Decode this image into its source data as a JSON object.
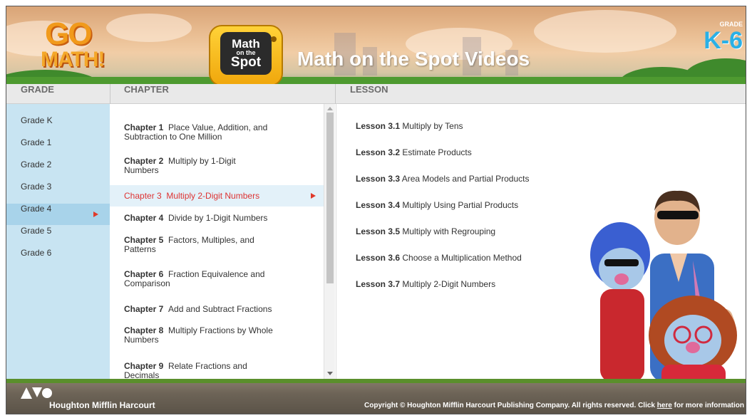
{
  "header": {
    "logo_go": "GO",
    "logo_math": "MATH!",
    "tv_line1": "Math",
    "tv_line2": "on the",
    "tv_line3": "Spot",
    "title": "Math on the Spot Videos",
    "grade_label": "GRADE",
    "grade_range": "K-6"
  },
  "columns": {
    "grade": "GRADE",
    "chapter": "CHAPTER",
    "lesson": "LESSON"
  },
  "grades": [
    "Grade K",
    "Grade 1",
    "Grade 2",
    "Grade 3",
    "Grade 4",
    "Grade 5",
    "Grade 6"
  ],
  "selected_grade": "Grade 4",
  "chapters": [
    {
      "num": "Chapter 1",
      "title": "Place Value, Addition, and",
      "title2": "Subtraction to One Million"
    },
    {
      "num": "Chapter 2",
      "title": "Multiply by 1-Digit",
      "title2": "Numbers"
    },
    {
      "num": "Chapter 3",
      "title": "Multiply 2-Digit Numbers",
      "title2": ""
    },
    {
      "num": "Chapter 4",
      "title": "Divide by 1-Digit Numbers",
      "title2": ""
    },
    {
      "num": "Chapter 5",
      "title": "Factors, Multiples, and",
      "title2": "Patterns"
    },
    {
      "num": "Chapter 6",
      "title": "Fraction Equivalence and",
      "title2": "Comparison"
    },
    {
      "num": "Chapter 7",
      "title": "Add and Subtract Fractions",
      "title2": ""
    },
    {
      "num": "Chapter 8",
      "title": "Multiply Fractions by Whole",
      "title2": "Numbers"
    },
    {
      "num": "Chapter 9",
      "title": "Relate Fractions and",
      "title2": "Decimals"
    }
  ],
  "selected_chapter": "Chapter 3",
  "lessons": [
    {
      "num": "Lesson 3.1",
      "title": "Multiply by Tens"
    },
    {
      "num": "Lesson 3.2",
      "title": "Estimate Products"
    },
    {
      "num": "Lesson 3.3",
      "title": "Area Models and Partial Products"
    },
    {
      "num": "Lesson 3.4",
      "title": "Multiply Using Partial Products"
    },
    {
      "num": "Lesson 3.5",
      "title": "Multiply with Regrouping"
    },
    {
      "num": "Lesson 3.6",
      "title": "Choose a Multiplication Method"
    },
    {
      "num": "Lesson 3.7",
      "title": "Multiply 2-Digit Numbers"
    }
  ],
  "footer": {
    "company": "Houghton Mifflin Harcourt",
    "copyright_pre": "Copyright © Houghton Mifflin Harcourt Publishing Company. All rights reserved. Click ",
    "copyright_link": "here",
    "copyright_post": " for more information"
  },
  "colors": {
    "grade_bg": "#c8e4f2",
    "grade_selected_bg": "#a8d3ea",
    "chapter_selected_bg": "#e3f1f9",
    "selected_text": "#d33333",
    "arrow": "#e0392a",
    "title_text": "#ffffff",
    "grade_range_text": "#2ab0e6"
  }
}
